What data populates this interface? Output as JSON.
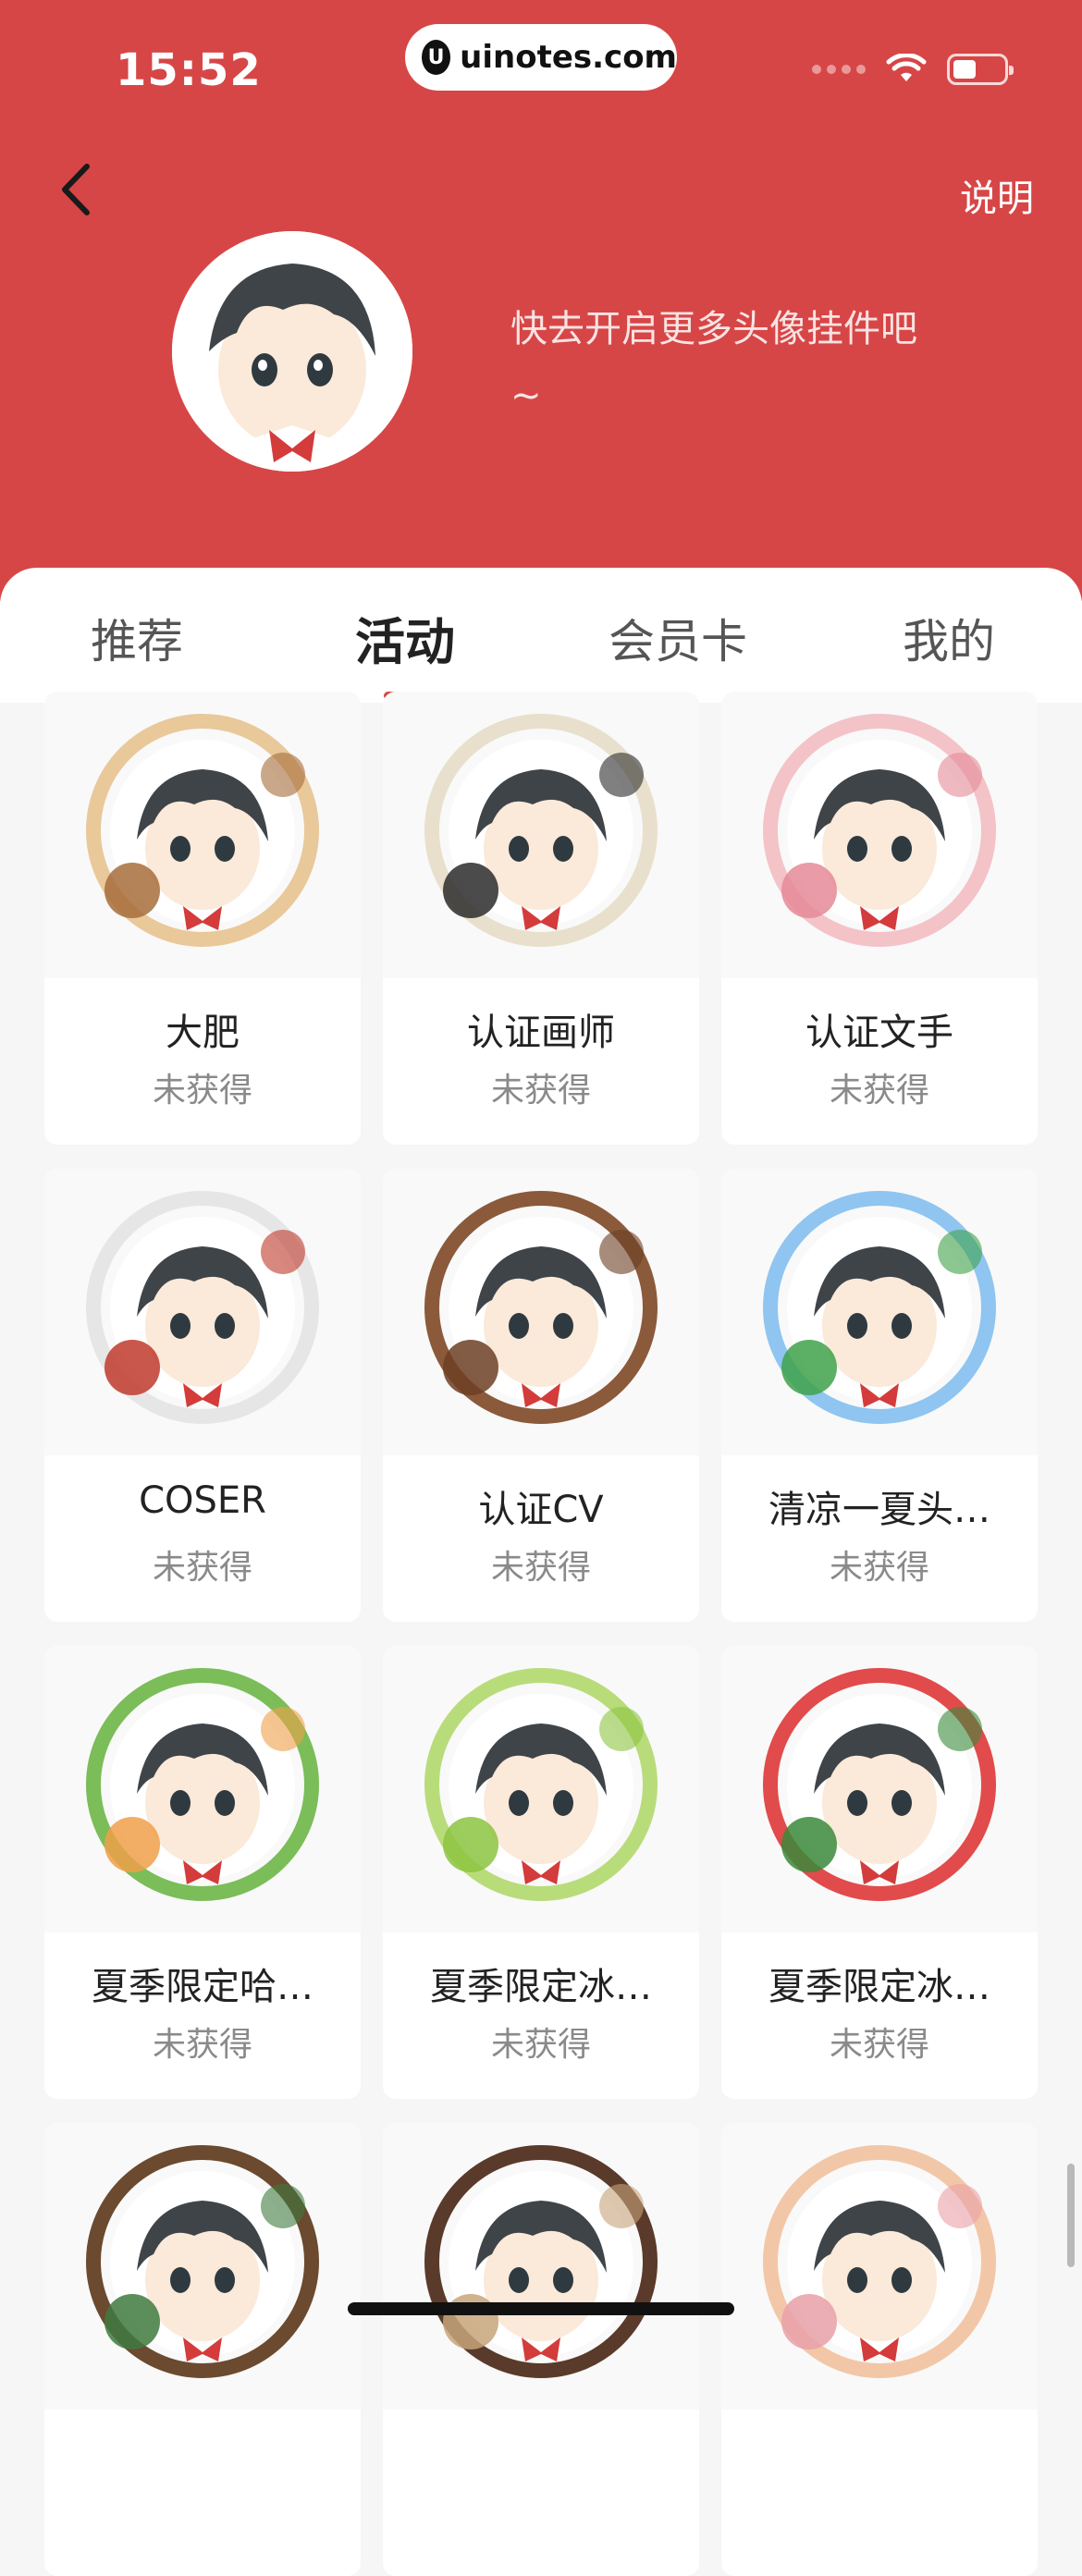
{
  "status_bar": {
    "time": "15:52",
    "url": "uinotes.com",
    "url_logo": "U"
  },
  "header": {
    "help_label": "说明",
    "tip_line1": "快去开启更多头像挂件吧",
    "tip_line2": "~"
  },
  "tabs": [
    {
      "label": "推荐"
    },
    {
      "label": "活动"
    },
    {
      "label": "会员卡"
    },
    {
      "label": "我的"
    }
  ],
  "active_tab": "活动",
  "items": [
    {
      "name": "大肥",
      "status": "未获得",
      "frame": "#e9c89a",
      "accent": "#a76d3b"
    },
    {
      "name": "认证画师",
      "status": "未获得",
      "frame": "#e8e0cc",
      "accent": "#2b2b2b"
    },
    {
      "name": "认证文手",
      "status": "未获得",
      "frame": "#f3c3c8",
      "accent": "#e58a98"
    },
    {
      "name": "COSER",
      "status": "未获得",
      "frame": "#e6e6e6",
      "accent": "#c0392b"
    },
    {
      "name": "认证CV",
      "status": "未获得",
      "frame": "#8a5a3b",
      "accent": "#6d3f24"
    },
    {
      "name": "清凉一夏头…",
      "status": "未获得",
      "frame": "#8fc5f0",
      "accent": "#3fa24a"
    },
    {
      "name": "夏季限定哈…",
      "status": "未获得",
      "frame": "#7bbd58",
      "accent": "#f0a04a"
    },
    {
      "name": "夏季限定冰…",
      "status": "未获得",
      "frame": "#b9dc7b",
      "accent": "#8cc43f"
    },
    {
      "name": "夏季限定冰…",
      "status": "未获得",
      "frame": "#e14b4b",
      "accent": "#3b8a3b"
    },
    {
      "name": "",
      "status": "",
      "frame": "#6b4a2f",
      "accent": "#3f7a3f"
    },
    {
      "name": "",
      "status": "",
      "frame": "#5a3a2a",
      "accent": "#c7a47a"
    },
    {
      "name": "",
      "status": "",
      "frame": "#f2c7a8",
      "accent": "#e9a0a8"
    }
  ],
  "colors": {
    "brand": "#d74646",
    "muted_text": "#8a8a8a"
  }
}
